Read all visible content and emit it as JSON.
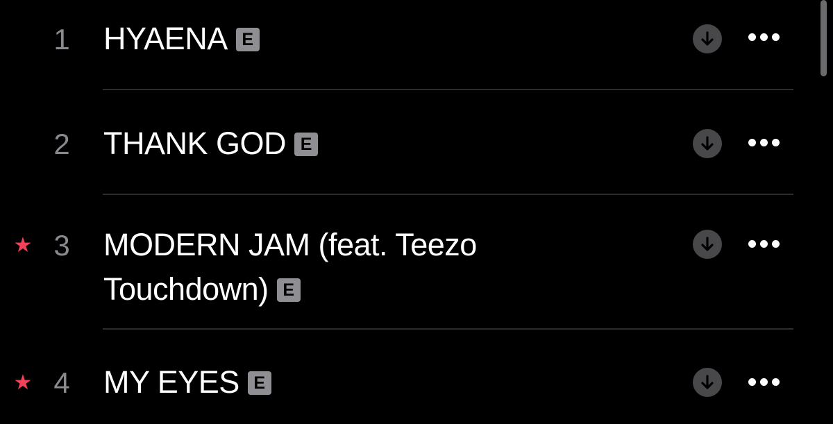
{
  "tracks": [
    {
      "number": "1",
      "title": "HYAENA",
      "explicit_label": "E",
      "starred": false
    },
    {
      "number": "2",
      "title": "THANK GOD",
      "explicit_label": "E",
      "starred": false
    },
    {
      "number": "3",
      "title_line1": "MODERN JAM (feat. Teezo",
      "title_line2": "Touchdown)",
      "explicit_label": "E",
      "starred": true
    },
    {
      "number": "4",
      "title": "MY EYES",
      "explicit_label": "E",
      "starred": true
    }
  ],
  "icons": {
    "star": "star-icon",
    "download": "download-icon",
    "more": "more-icon"
  },
  "colors": {
    "background": "#000000",
    "star": "#f2425a",
    "track_number": "#8a8a8e",
    "title": "#ffffff",
    "explicit_badge": "#8e8e93",
    "download_circle": "#48484b",
    "divider": "#2c2c2e"
  }
}
